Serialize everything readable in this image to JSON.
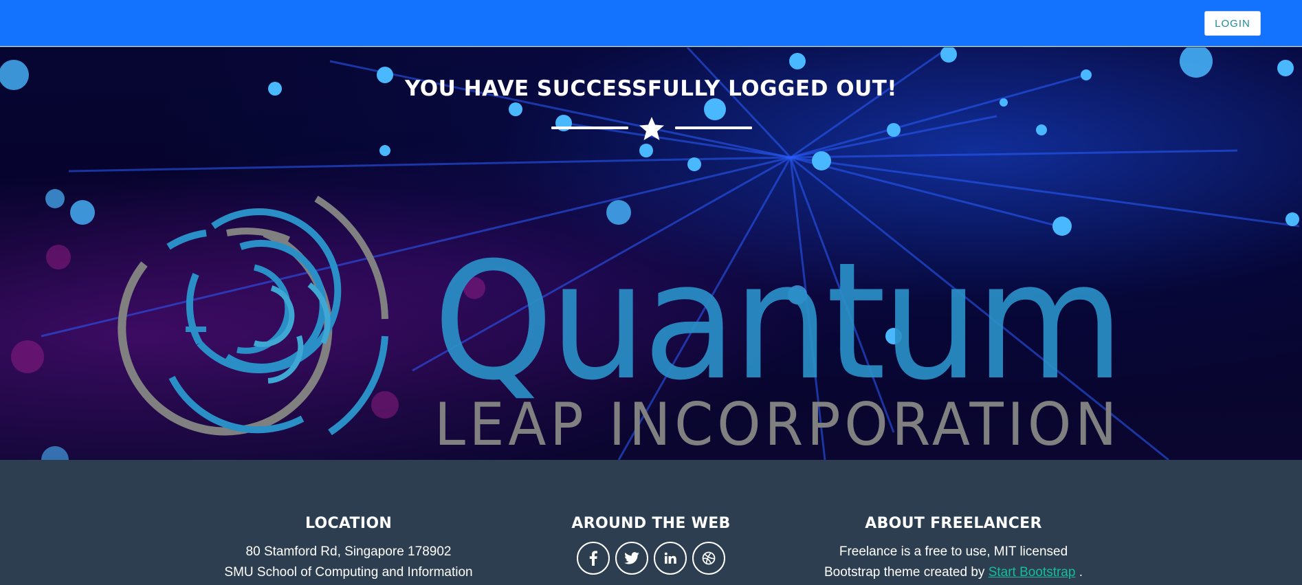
{
  "navbar": {
    "login_label": "LOGIN",
    "brand_color": "#1372fe"
  },
  "hero": {
    "title": "YOU HAVE SUCCESSFULLY LOGGED OUT!",
    "logo_wordmark": "Quantum",
    "logo_tagline": "LEAP INCORPORATION"
  },
  "footer": {
    "location": {
      "heading": "LOCATION",
      "line1": "80 Stamford Rd, Singapore 178902",
      "line2": "SMU School of Computing and Information"
    },
    "web": {
      "heading": "AROUND THE WEB",
      "icons": [
        "facebook-icon",
        "twitter-icon",
        "linkedin-icon",
        "dribbble-icon"
      ]
    },
    "about": {
      "heading": "ABOUT FREELANCER",
      "line1": "Freelance is a free to use, MIT licensed",
      "line2_prefix": "Bootstrap theme created by",
      "link_label": "Start Bootstrap",
      "line2_suffix": "."
    }
  },
  "colors": {
    "footer_bg": "#2c3e50",
    "link": "#18bc9c",
    "logo_blue": "#2a8fc7",
    "logo_gray": "#808080"
  }
}
